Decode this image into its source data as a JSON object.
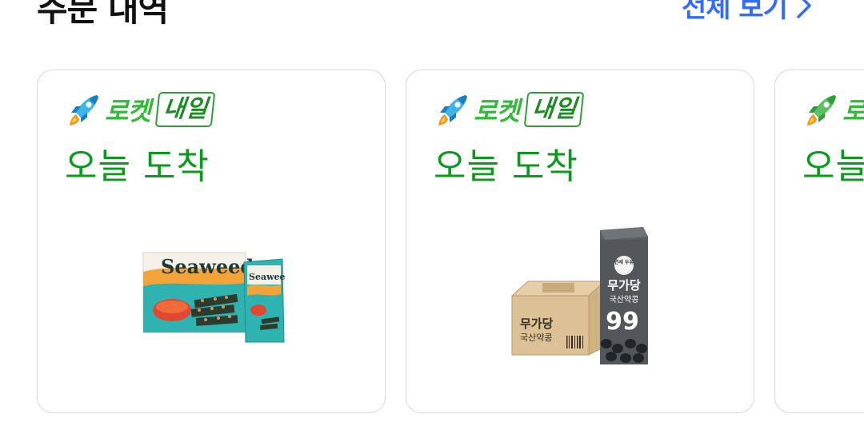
{
  "header": {
    "title": "주문 내역",
    "see_all_label": "전체 보기"
  },
  "colors": {
    "accent_blue": "#346aff",
    "rocket_green": "#35b93b",
    "arrival_green": "#0a9a1e",
    "card_border": "#d9d9d9"
  },
  "cards": [
    {
      "rocket_label": "로켓",
      "tomorrow_label": "내일",
      "arrival_text": "오늘 도착",
      "product_image": "seaweed-nuts-snack-box"
    },
    {
      "rocket_label": "로켓",
      "tomorrow_label": "내일",
      "arrival_text": "오늘 도착",
      "product_image": "soy-milk-carton-box",
      "product_texts": {
        "carton_brand": "연세 두유",
        "carton_name": "무가당",
        "carton_sub": "국산약콩",
        "carton_percent": "99",
        "box_name": "무가당",
        "box_sub": "국산약콩"
      }
    },
    {
      "rocket_label": "로켓",
      "arrival_text": "오늘 도착"
    }
  ]
}
